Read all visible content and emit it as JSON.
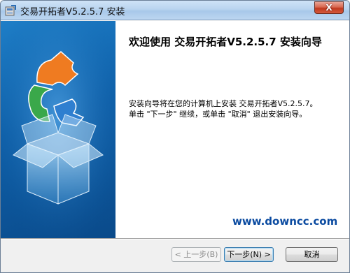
{
  "window": {
    "title": "交易开拓者V5.2.5.7 安装",
    "close_label": "X"
  },
  "welcome": {
    "title": "欢迎使用 交易开拓者V5.2.5.7 安装向导",
    "line1": "安装向导将在您的计算机上安装 交易开拓者V5.2.5.7。",
    "line2": "单击 \"下一步\" 继续，或单击 \"取消\" 退出安装向导。"
  },
  "watermark": "www.downcc.com",
  "buttons": {
    "back": "< 上一步(B)",
    "next": "下一步(N) >",
    "cancel": "取消"
  },
  "colors": {
    "banner": "#0e5fa8",
    "watermark": "#0a4aa0",
    "close": "#c0391f"
  }
}
